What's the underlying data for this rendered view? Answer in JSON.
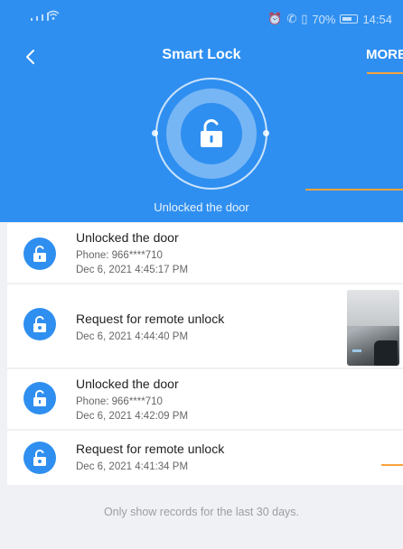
{
  "status_bar": {
    "right_text": "70%",
    "time": "14:54"
  },
  "nav": {
    "title": "Smart Lock",
    "more_label": "MORE"
  },
  "lock": {
    "status": "Unlocked the door",
    "icon": "unlocked-padlock-icon"
  },
  "records": [
    {
      "title": "Unlocked the door",
      "phone": "Phone: 966****710",
      "time": "Dec 6, 2021 4:45:17 PM",
      "icon": "unlocked-padlock-icon"
    },
    {
      "title": "Request for remote unlock",
      "time": "Dec 6, 2021 4:44:40 PM",
      "icon": "remote-unlock-icon",
      "has_photo": true
    },
    {
      "title": "Unlocked the door",
      "phone": "Phone: 966****710",
      "time": "Dec 6, 2021 4:42:09 PM",
      "icon": "unlocked-padlock-icon"
    },
    {
      "title": "Request for remote unlock",
      "time": "Dec 6, 2021 4:41:34 PM",
      "icon": "remote-unlock-icon"
    }
  ],
  "footer_note": "Only show records for the last 30 days.",
  "colors": {
    "primary": "#2f8ff0",
    "accent_orange": "#f7a33b",
    "background": "#f0f1f4"
  }
}
